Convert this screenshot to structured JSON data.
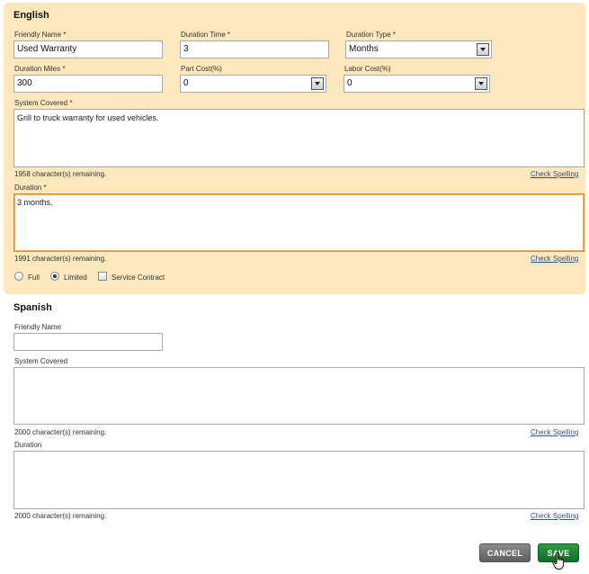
{
  "english": {
    "title": "English",
    "friendly_name": {
      "label": "Friendly Name *",
      "value": "Used Warranty"
    },
    "duration_time": {
      "label": "Duration Time *",
      "value": "3"
    },
    "duration_type": {
      "label": "Duration Type *",
      "value": "Months"
    },
    "duration_miles": {
      "label": "Duration Miles *",
      "value": "300"
    },
    "part_cost": {
      "label": "Part Cost(%)",
      "value": "0"
    },
    "labor_cost": {
      "label": "Labor Cost(%)",
      "value": "0"
    },
    "system_covered": {
      "label": "System Covered *",
      "value": "Grill to truck warranty for used vehicles.",
      "remaining": "1958 character(s) remaining."
    },
    "duration": {
      "label": "Duration *",
      "value": "3 months.",
      "remaining": "1991 character(s) remaining."
    },
    "coverage": {
      "full": "Full",
      "limited": "Limited",
      "service_contract": "Service Contract",
      "selected": "Limited"
    }
  },
  "spanish": {
    "title": "Spanish",
    "friendly_name": {
      "label": "Friendly Name",
      "value": ""
    },
    "system_covered": {
      "label": "System Covered",
      "value": "",
      "remaining": "2000 character(s) remaining."
    },
    "duration": {
      "label": "Duration",
      "value": "",
      "remaining": "2000 character(s) remaining."
    }
  },
  "check_spelling": "Check Spelling",
  "buttons": {
    "cancel": "CANCEL",
    "save": "SAVE"
  }
}
